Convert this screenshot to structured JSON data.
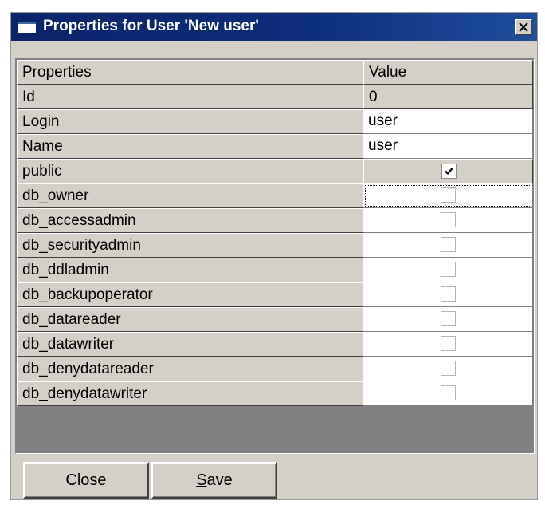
{
  "window": {
    "title": "Properties for User 'New user'",
    "close_glyph": "×"
  },
  "grid": {
    "columns": [
      "Properties",
      "Value"
    ],
    "rows": [
      {
        "property": "Id",
        "value": "0",
        "kind": "text-readonly"
      },
      {
        "property": "Login",
        "value": "user",
        "kind": "text"
      },
      {
        "property": "Name",
        "value": "user",
        "kind": "text"
      },
      {
        "property": "public",
        "checked": true,
        "kind": "checkbox"
      },
      {
        "property": "db_owner",
        "checked": false,
        "kind": "checkbox",
        "focused": true
      },
      {
        "property": "db_accessadmin",
        "checked": false,
        "kind": "checkbox"
      },
      {
        "property": "db_securityadmin",
        "checked": false,
        "kind": "checkbox"
      },
      {
        "property": "db_ddladmin",
        "checked": false,
        "kind": "checkbox"
      },
      {
        "property": "db_backupoperator",
        "checked": false,
        "kind": "checkbox"
      },
      {
        "property": "db_datareader",
        "checked": false,
        "kind": "checkbox"
      },
      {
        "property": "db_datawriter",
        "checked": false,
        "kind": "checkbox"
      },
      {
        "property": "db_denydatareader",
        "checked": false,
        "kind": "checkbox"
      },
      {
        "property": "db_denydatawriter",
        "checked": false,
        "kind": "checkbox"
      }
    ]
  },
  "buttons": {
    "close_label": "Close",
    "save_accel": "S",
    "save_rest": "ave"
  },
  "colors": {
    "title_bar": "#0a246a",
    "face": "#d4d0c8",
    "empty_area": "#808080"
  }
}
